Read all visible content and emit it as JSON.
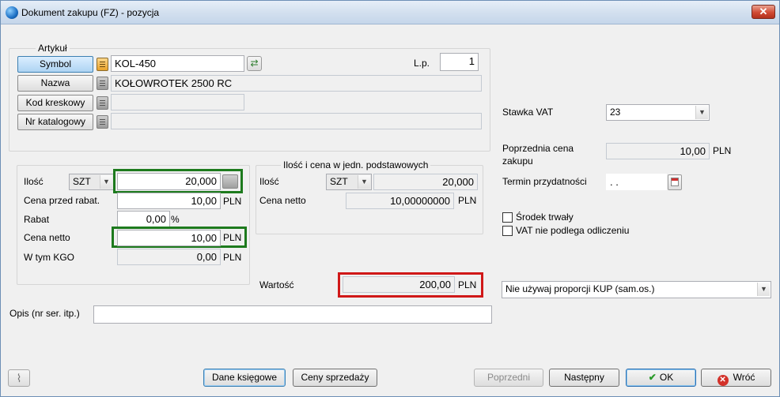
{
  "window": {
    "title": "Dokument zakupu (FZ) - pozycja",
    "close_glyph": "✕"
  },
  "artykul": {
    "group_title": "Artykuł",
    "symbol_label": "Symbol",
    "symbol_value": "KOL-450",
    "nazwa_label": "Nazwa",
    "nazwa_value": "KOŁOWROTEK  2500 RC",
    "kod_label": "Kod kreskowy",
    "kod_value": "",
    "nr_kat_label": "Nr katalogowy",
    "nr_kat_value": "",
    "lp_label": "L.p.",
    "lp_value": "1"
  },
  "vat": {
    "label": "Stawka VAT",
    "value": "23",
    "prev_price_label": "Poprzednia cena",
    "prev_price_label2": "zakupu",
    "prev_price_value": "10,00",
    "prev_price_unit": "PLN",
    "expiry_label": "Termin przydatności",
    "expiry_value": " .  .",
    "srodek_label": "Środek trwały",
    "vat_nie_label": "VAT nie podlega odliczeniu",
    "kup_value": "Nie używaj proporcji KUP (sam.os.)"
  },
  "left_panel": {
    "ilosc_label": "Ilość",
    "ilosc_unit": "SZT",
    "ilosc_value": "20,000",
    "cena_przed_label": "Cena przed rabat.",
    "cena_przed_value": "10,00",
    "cena_przed_unit": "PLN",
    "rabat_label": "Rabat",
    "rabat_value": "0,00",
    "rabat_unit": "%",
    "cena_netto_label": "Cena netto",
    "cena_netto_value": "10,00",
    "cena_netto_unit": "PLN",
    "kgo_label": "W tym KGO",
    "kgo_value": "0,00",
    "kgo_unit": "PLN"
  },
  "base_units": {
    "group_title": "Ilość i cena w jedn. podstawowych",
    "ilosc_label": "Ilość",
    "ilosc_unit": "SZT",
    "ilosc_value": "20,000",
    "cena_label": "Cena netto",
    "cena_value": "10,00000000",
    "cena_unit": "PLN"
  },
  "wartosc": {
    "label": "Wartość",
    "value": "200,00",
    "unit": "PLN"
  },
  "opis": {
    "label": "Opis (nr ser. itp.)",
    "value": ""
  },
  "buttons": {
    "dane": "Dane księgowe",
    "ceny": "Ceny sprzedaży",
    "poprzedni": "Poprzedni",
    "nastepny": "Następny",
    "ok": "OK",
    "wroc": "Wróć"
  },
  "colors": {
    "green_highlight": "#1d7a1d",
    "red_highlight": "#d01818"
  }
}
